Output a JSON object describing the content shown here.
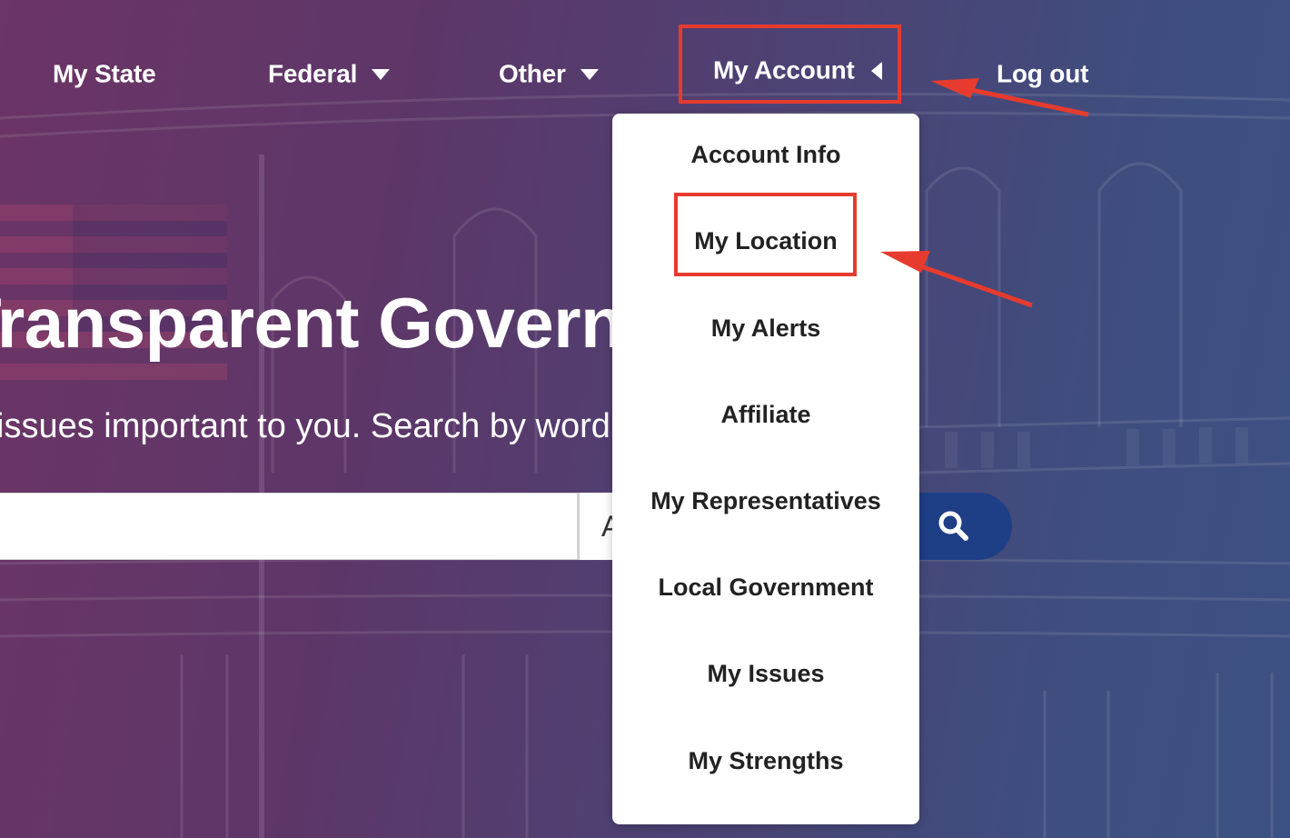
{
  "nav": {
    "my_state": "My State",
    "federal": "Federal",
    "other": "Other",
    "my_account": "My Account",
    "log_out": "Log out"
  },
  "hero": {
    "title": "Transparent Government",
    "subtitle": "issues important to you. Search by word"
  },
  "search": {
    "input_value": "",
    "select_value": "A"
  },
  "account_menu": {
    "items": [
      "Account Info",
      "My Location",
      "My Alerts",
      "Affiliate",
      "My Representatives",
      "Local Government",
      "My Issues",
      "My Strengths"
    ]
  },
  "colors": {
    "highlight": "#e63b2e",
    "search_button": "#1e3e86",
    "menu_text": "#222222"
  }
}
